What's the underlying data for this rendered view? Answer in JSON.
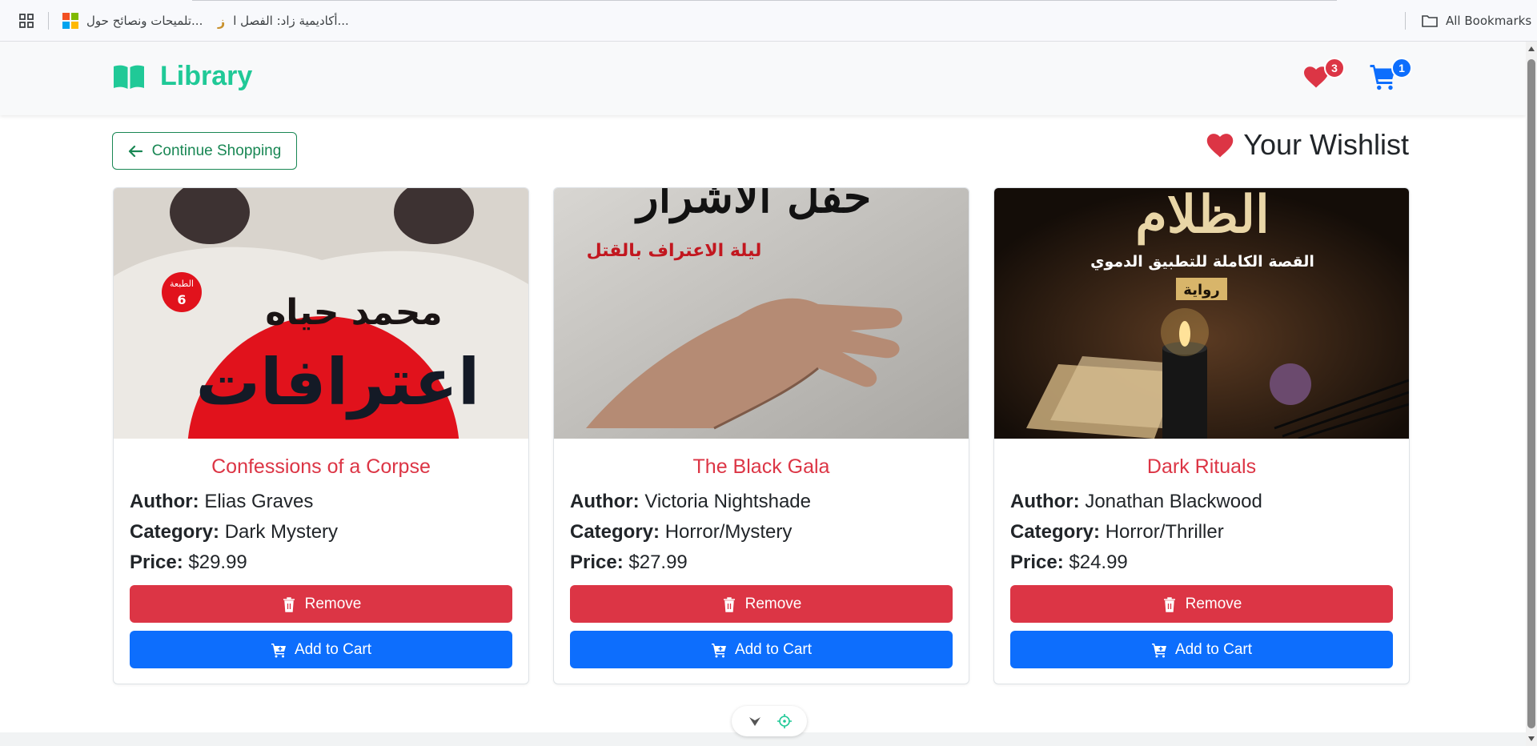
{
  "bookmarks": {
    "items": [
      {
        "label": "تلميحات ونصائح حول...",
        "icon": "microsoft-logo"
      },
      {
        "label": "أكاديمية زاد: الفصل ا...",
        "icon": "zad-logo"
      }
    ],
    "all_bookmarks": "All Bookmarks"
  },
  "navbar": {
    "brand": "Library",
    "brand_color": "#20c997",
    "wishlist_count": "3",
    "cart_count": "1"
  },
  "header": {
    "continue_label": "Continue Shopping",
    "wishlist_title": "Your Wishlist"
  },
  "labels": {
    "author": "Author:",
    "category": "Category:",
    "price": "Price:",
    "remove": "Remove",
    "add_to_cart": "Add to Cart"
  },
  "books": [
    {
      "title": "Confessions of a Corpse",
      "author": "Elias Graves",
      "category": "Dark Mystery",
      "price": "$29.99",
      "cover": {
        "arabic_author": "محمد حياه",
        "arabic_title": "اعترافات",
        "edition_label": "الطبعة",
        "edition": "6"
      }
    },
    {
      "title": "The Black Gala",
      "author": "Victoria Nightshade",
      "category": "Horror/Mystery",
      "price": "$27.99",
      "cover": {
        "arabic_subtitle": "ليلة الاعتراف بالقتل",
        "arabic_title": "حفل الأشرار"
      }
    },
    {
      "title": "Dark Rituals",
      "author": "Jonathan Blackwood",
      "category": "Horror/Thriller",
      "price": "$24.99",
      "cover": {
        "arabic_title": "الظلام",
        "arabic_subtitle": "القصة الكاملة للتطبيق الدموي",
        "arabic_tag": "رواية"
      }
    }
  ],
  "colors": {
    "danger": "#dc3545",
    "primary": "#0d6efd",
    "success": "#198754"
  }
}
